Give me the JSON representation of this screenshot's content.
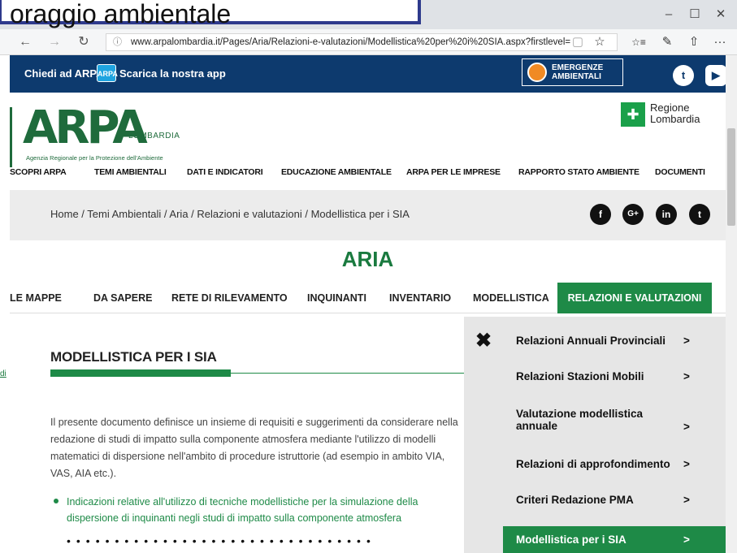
{
  "caption": {
    "text": "oraggio ambientale"
  },
  "browser": {
    "back": "←",
    "forward": "→",
    "refresh": "↻",
    "url_info": "ⓘ",
    "url": "www.arpalombardia.it/Pages/Aria/Relazioni-e-valutazioni/Modellistica%20per%20i%20SIA.aspx?firstlevel=",
    "reading_view": "▢",
    "favorite": "☆",
    "favorites_bar": "☆≡",
    "pen": "✎",
    "share": "⇧",
    "more": "···",
    "minimize": "–",
    "maximize": "☐",
    "close": "✕"
  },
  "topbar": {
    "ask": "Chiedi ad ARPA |",
    "app_icon": "ARPA",
    "app": "Scarica la nostra app",
    "emergency": "EMERGENZE\nAMBIENTALI",
    "twitter": "t",
    "youtube": "▶"
  },
  "header": {
    "logo": "ARPA",
    "logo_region": "LOMBARDIA",
    "logo_sub": "Agenzia Regionale per la Protezione dell'Ambiente",
    "regione": "Regione\nLombardia"
  },
  "mainnav": [
    "SCOPRI ARPA",
    "TEMI AMBIENTALI",
    "DATI E INDICATORI",
    "EDUCAZIONE AMBIENTALE",
    "ARPA PER LE IMPRESE",
    "RAPPORTO STATO AMBIENTE",
    "DOCUMENTI"
  ],
  "breadcrumb": "Home / Temi Ambientali / Aria / Relazioni e valutazioni / Modellistica per i SIA",
  "social": [
    "f",
    "G+",
    "in",
    "t"
  ],
  "section_title": "ARIA",
  "subnav": {
    "items": [
      "LE MAPPE",
      "DA SAPERE",
      "RETE DI RILEVAMENTO",
      "INQUINANTI",
      "INVENTARIO",
      "MODELLISTICA"
    ],
    "active": "RELAZIONI E VALUTAZIONI"
  },
  "content": {
    "title": "MODELLISTICA PER I SIA",
    "body": "Il presente documento definisce un insieme di requisiti e suggerimenti da considerare nella redazione di studi di impatto sulla componente atmosfera mediante l'utilizzo di modelli matematici di dispersione nell'ambito di procedure istruttorie (ad esempio in ambito VIA, VAS, AIA etc.).",
    "bullet": "Indicazioni relative all'utilizzo di tecniche modellistiche per la simulazione della dispersione di inquinanti negli studi di impatto sulla componente atmosfera",
    "dots": "••••••••••••••••••••••••••••••••"
  },
  "gutter_link": "di",
  "sidepanel": {
    "close": "✖",
    "items": [
      {
        "label": "Relazioni Annuali Provinciali",
        "arrow": ">"
      },
      {
        "label": "Relazioni Stazioni Mobili",
        "arrow": ">"
      },
      {
        "label": "Valutazione modellistica annuale",
        "arrow": ">"
      },
      {
        "label": "Relazioni di approfondimento",
        "arrow": ">"
      },
      {
        "label": "Criteri Redazione PMA",
        "arrow": ">"
      }
    ],
    "active": {
      "label": "Modellistica per i SIA",
      "arrow": ">"
    }
  },
  "colors": {
    "green": "#1e8a47",
    "navy": "#0d3a6e"
  }
}
